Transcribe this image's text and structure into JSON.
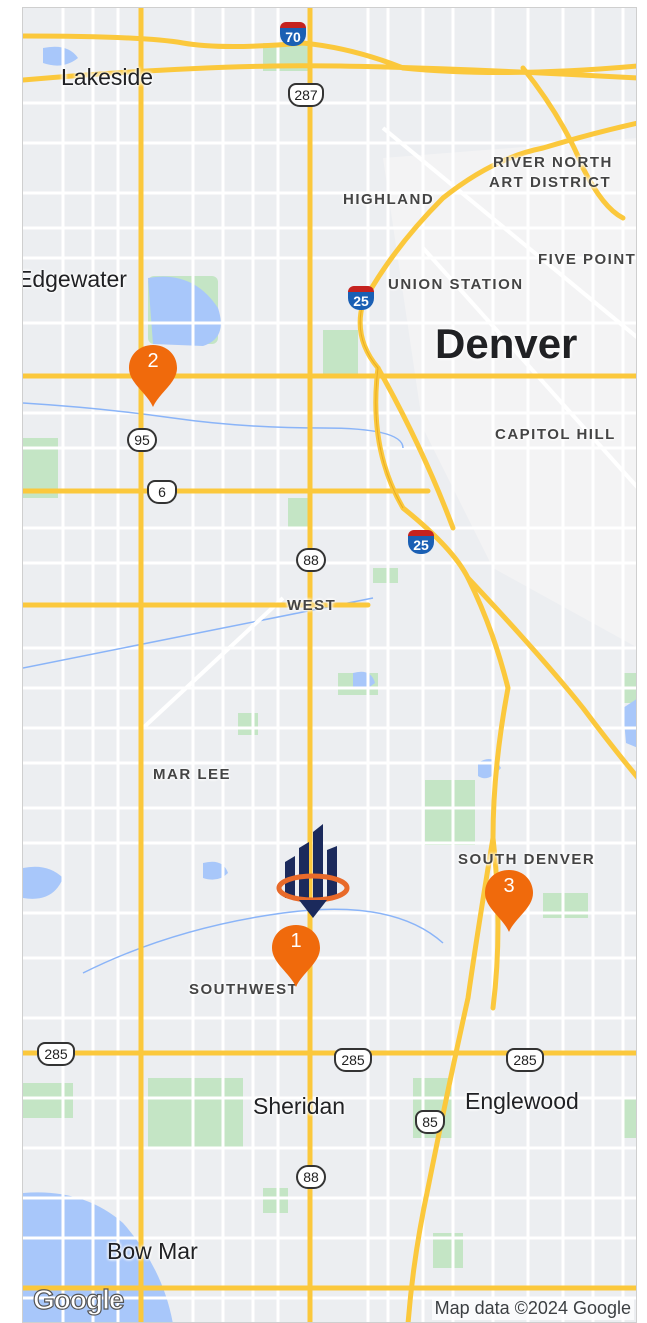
{
  "map": {
    "colors": {
      "land": "#eceef1",
      "street": "#ffffff",
      "highway": "#fbc83c",
      "park": "#c4e5c5",
      "water": "#a8c7fa",
      "pin": "#f06a0c",
      "logo_navy": "#1b2a5c",
      "logo_orange": "#e86a2a"
    },
    "labels": {
      "lakeside": "Lakeside",
      "edgewater": "Edgewater",
      "highland": "HIGHLAND",
      "river_north_1": "RIVER NORTH",
      "river_north_2": "ART DISTRICT",
      "five_points": "FIVE POINT",
      "union_station": "UNION STATION",
      "denver": "Denver",
      "capitol_hill": "CAPITOL HILL",
      "west": "WEST",
      "mar_lee": "MAR LEE",
      "south_denver": "SOUTH DENVER",
      "southwest": "SOUTHWEST",
      "sheridan": "Sheridan",
      "englewood": "Englewood",
      "bow_mar": "Bow Mar"
    },
    "shields": {
      "i70": "70",
      "us287": "287",
      "i25_north": "25",
      "co95": "95",
      "us6": "6",
      "i25_south": "25",
      "co88_north": "88",
      "us285_west": "285",
      "us285_center": "285",
      "us285_east": "285",
      "us85": "85",
      "co88_south": "88"
    },
    "pins": [
      {
        "label": "1"
      },
      {
        "label": "2"
      },
      {
        "label": "3"
      }
    ],
    "attribution": "Map data ©2024 Google",
    "google_logo": "Google"
  }
}
